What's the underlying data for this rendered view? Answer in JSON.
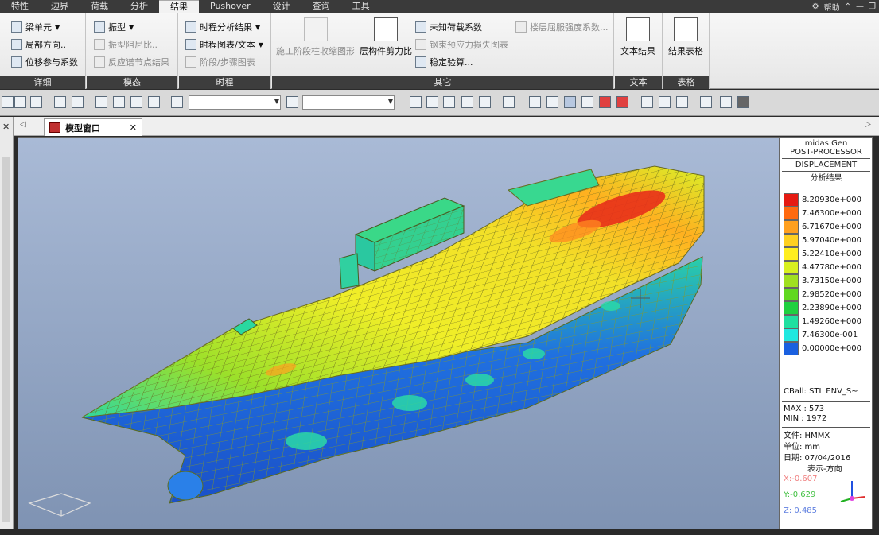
{
  "menu": {
    "tabs": [
      "特性",
      "边界",
      "荷载",
      "分析",
      "结果",
      "Pushover",
      "设计",
      "查询",
      "工具"
    ],
    "active_tab": "结果",
    "help": "帮助"
  },
  "ribbon": {
    "groups": {
      "detail": {
        "title": "详细",
        "items": [
          "梁单元",
          "局部方向..",
          "位移参与系数"
        ]
      },
      "modal": {
        "title": "模态",
        "items": [
          "振型",
          "振型阻尼比..",
          "反应谱节点结果"
        ]
      },
      "time_history": {
        "title": "时程",
        "items": [
          "时程分析结果",
          "时程图表/文本",
          "阶段/步骤图表"
        ]
      },
      "other": {
        "title": "其它",
        "big_items": [
          "施工阶段柱收缩图形",
          "层构件剪力比"
        ],
        "items": [
          "未知荷载系数",
          "钢束预应力损失图表",
          "稳定验算...",
          "楼层屈服强度系数..."
        ]
      },
      "text": {
        "title": "文本",
        "button": "文本结果"
      },
      "table": {
        "title": "表格",
        "button": "结果表格"
      }
    }
  },
  "toolbar": {
    "combo1_value": "",
    "combo2_value": ""
  },
  "tabbar": {
    "tab_label": "模型窗口"
  },
  "legend": {
    "header1": "midas Gen",
    "header2": "POST-PROCESSOR",
    "header3": "DISPLACEMENT",
    "subtitle": "分析结果",
    "levels": [
      {
        "value": "8.20930e+000",
        "color": "#e51a12"
      },
      {
        "value": "7.46300e+000",
        "color": "#ff6a10"
      },
      {
        "value": "6.71670e+000",
        "color": "#ffa020"
      },
      {
        "value": "5.97040e+000",
        "color": "#ffd020"
      },
      {
        "value": "5.22410e+000",
        "color": "#ffee20"
      },
      {
        "value": "4.47780e+000",
        "color": "#d8f020"
      },
      {
        "value": "3.73150e+000",
        "color": "#a0e020"
      },
      {
        "value": "2.98520e+000",
        "color": "#60d820"
      },
      {
        "value": "2.23890e+000",
        "color": "#20d040"
      },
      {
        "value": "1.49260e+000",
        "color": "#20e0a0"
      },
      {
        "value": "7.46300e-001",
        "color": "#20e8e0"
      },
      {
        "value": "0.00000e+000",
        "color": "#1a60e0"
      }
    ],
    "load_case": "CBall: STL ENV_S~",
    "max": "MAX : 573",
    "min": "MIN : 1972",
    "file": "文件: HMMX",
    "unit": "单位: mm",
    "date": "日期: 07/04/2016",
    "direction_title": "表示-方向",
    "x": "X:-0.607",
    "y": "Y:-0.629",
    "z": "Z: 0.485"
  }
}
